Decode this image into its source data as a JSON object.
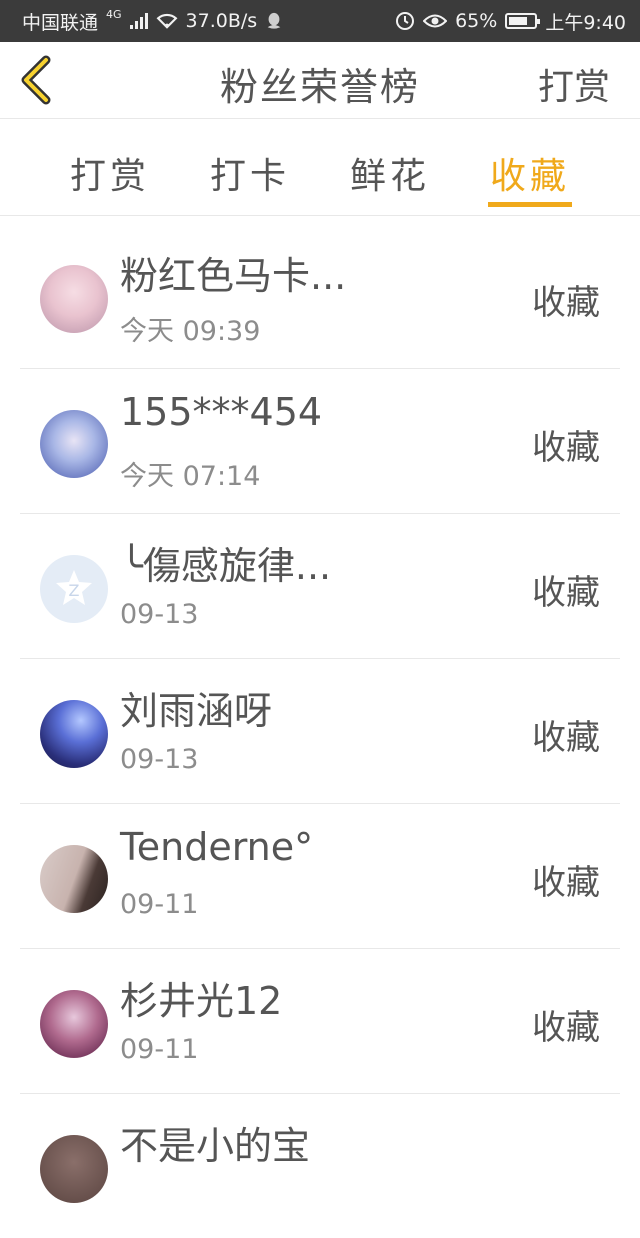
{
  "status_bar": {
    "carrier": "中国联通",
    "network": "4G",
    "speed": "37.0B/s",
    "battery_pct": "65%",
    "time": "上午9:40"
  },
  "header": {
    "title": "粉丝荣誉榜",
    "action": "打赏"
  },
  "tabs": [
    {
      "label": "打赏",
      "active": false
    },
    {
      "label": "打卡",
      "active": false
    },
    {
      "label": "鲜花",
      "active": false
    },
    {
      "label": "收藏",
      "active": true
    }
  ],
  "accent_color": "#f0a91b",
  "fans": [
    {
      "name": "粉红色马卡...",
      "time": "今天 09:39",
      "tag": "收藏"
    },
    {
      "name": "155***454",
      "time": "今天 07:14",
      "tag": "收藏"
    },
    {
      "name": "╰傷感旋律...",
      "time": "09-13",
      "tag": "收藏"
    },
    {
      "name": "刘雨涵呀",
      "time": "09-13",
      "tag": "收藏"
    },
    {
      "name": "Tenderne°",
      "time": "09-11",
      "tag": "收藏"
    },
    {
      "name": "杉井光12",
      "time": "09-11",
      "tag": "收藏"
    },
    {
      "name": "不是小的宝",
      "time": "",
      "tag": ""
    }
  ]
}
